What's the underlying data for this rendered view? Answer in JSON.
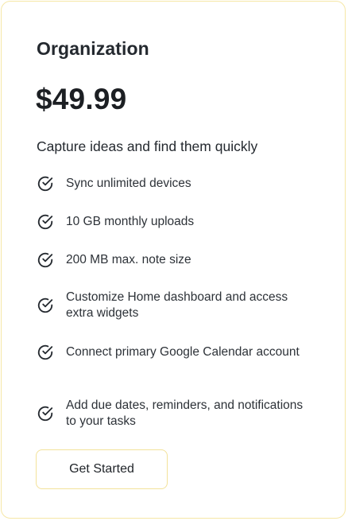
{
  "plan": {
    "name": "Organization",
    "price": "$49.99",
    "tagline": "Capture ideas and find them quickly",
    "features": [
      "Sync unlimited devices",
      "10 GB monthly uploads",
      "200 MB max. note size",
      "Customize Home dashboard and access extra widgets",
      "Connect primary Google Calendar account",
      "Add due dates, reminders, and notifications to your tasks"
    ],
    "feature_icon": "check-circle-icon",
    "cta_label": "Get Started"
  },
  "colors": {
    "card_border": "#f6e7a6",
    "button_border": "#f3e29a",
    "text": "#1f2328"
  }
}
